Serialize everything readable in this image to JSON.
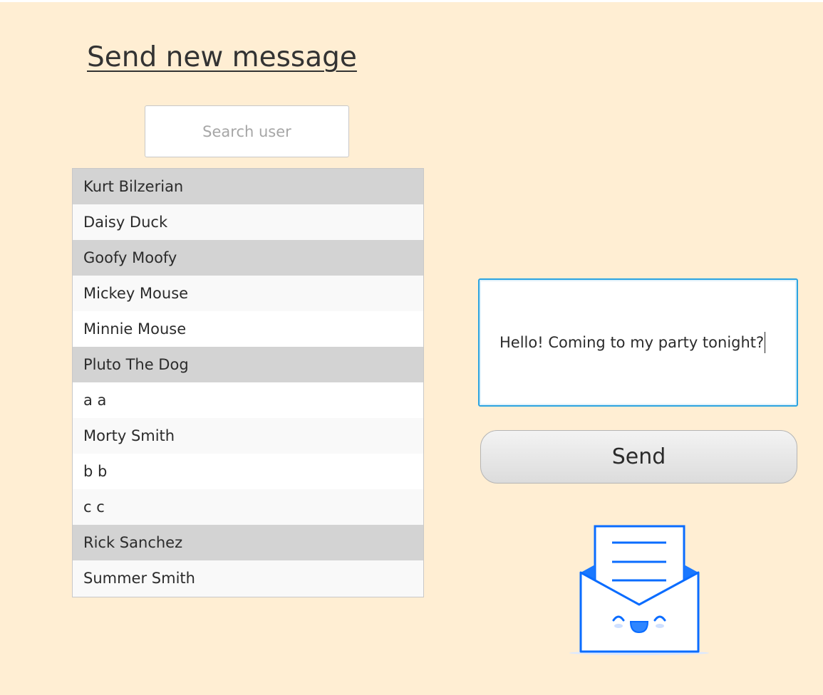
{
  "page": {
    "title": "Send new message"
  },
  "search": {
    "placeholder": "Search user",
    "value": ""
  },
  "users": [
    {
      "name": "Kurt Bilzerian",
      "shade": "gray"
    },
    {
      "name": "Daisy Duck",
      "shade": "light"
    },
    {
      "name": "Goofy Moofy",
      "shade": "gray"
    },
    {
      "name": "Mickey Mouse",
      "shade": "light"
    },
    {
      "name": "Minnie Mouse",
      "shade": "white"
    },
    {
      "name": "Pluto The Dog",
      "shade": "gray"
    },
    {
      "name": "a a",
      "shade": "white"
    },
    {
      "name": "Morty Smith",
      "shade": "light"
    },
    {
      "name": "b b",
      "shade": "white"
    },
    {
      "name": "c c",
      "shade": "light"
    },
    {
      "name": "Rick Sanchez",
      "shade": "gray"
    },
    {
      "name": "Summer Smith",
      "shade": "light"
    }
  ],
  "message": {
    "value": "Hello! Coming to my party tonight?"
  },
  "send_button": {
    "label": "Send"
  },
  "illustration": {
    "icon": "smiling-envelope-icon"
  },
  "colors": {
    "background": "#ffeed3",
    "accent": "#0a6cff",
    "focus_border": "#2ba3e0",
    "selected_row": "#d3d3d3"
  }
}
